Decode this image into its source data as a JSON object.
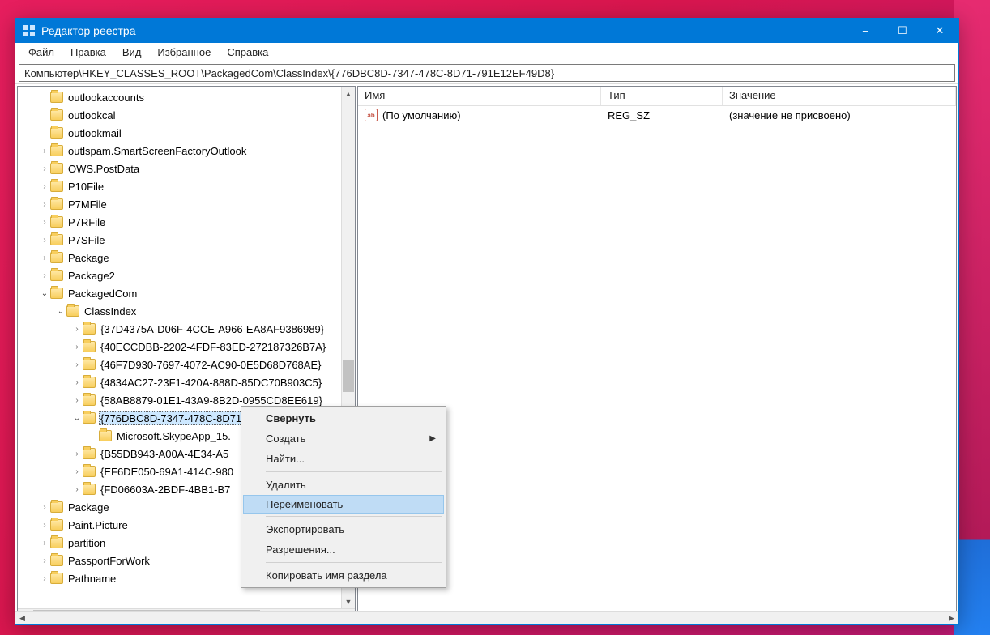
{
  "window": {
    "title": "Редактор реестра",
    "menubar": [
      "Файл",
      "Правка",
      "Вид",
      "Избранное",
      "Справка"
    ],
    "controls": {
      "min": "−",
      "max": "☐",
      "close": "✕"
    }
  },
  "address": "Компьютер\\HKEY_CLASSES_ROOT\\PackagedCom\\ClassIndex\\{776DBC8D-7347-478C-8D71-791E12EF49D8}",
  "tree": [
    {
      "indent": 1,
      "expander": "",
      "label": "outlookaccounts"
    },
    {
      "indent": 1,
      "expander": "",
      "label": "outlookcal"
    },
    {
      "indent": 1,
      "expander": "",
      "label": "outlookmail"
    },
    {
      "indent": 1,
      "expander": "closed",
      "label": "outlspam.SmartScreenFactoryOutlook"
    },
    {
      "indent": 1,
      "expander": "closed",
      "label": "OWS.PostData"
    },
    {
      "indent": 1,
      "expander": "closed",
      "label": "P10File"
    },
    {
      "indent": 1,
      "expander": "closed",
      "label": "P7MFile"
    },
    {
      "indent": 1,
      "expander": "closed",
      "label": "P7RFile"
    },
    {
      "indent": 1,
      "expander": "closed",
      "label": "P7SFile"
    },
    {
      "indent": 1,
      "expander": "closed",
      "label": "Package"
    },
    {
      "indent": 1,
      "expander": "closed",
      "label": "Package2"
    },
    {
      "indent": 1,
      "expander": "open",
      "label": "PackagedCom"
    },
    {
      "indent": 2,
      "expander": "open",
      "label": "ClassIndex"
    },
    {
      "indent": 3,
      "expander": "closed",
      "label": "{37D4375A-D06F-4CCE-A966-EA8AF9386989}"
    },
    {
      "indent": 3,
      "expander": "closed",
      "label": "{40ECCDBB-2202-4FDF-83ED-272187326B7A}"
    },
    {
      "indent": 3,
      "expander": "closed",
      "label": "{46F7D930-7697-4072-AC90-0E5D68D768AE}"
    },
    {
      "indent": 3,
      "expander": "closed",
      "label": "{4834AC27-23F1-420A-888D-85DC70B903C5}"
    },
    {
      "indent": 3,
      "expander": "closed",
      "label": "{58AB8879-01E1-43A9-8B2D-0955CD8EE619}"
    },
    {
      "indent": 3,
      "expander": "open",
      "label": "{776DBC8D-7347-478C-8D71-791E12EF49D8}",
      "selected": true
    },
    {
      "indent": 4,
      "expander": "",
      "label": "Microsoft.SkypeApp_15."
    },
    {
      "indent": 3,
      "expander": "closed",
      "label": "{B55DB943-A00A-4E34-A5"
    },
    {
      "indent": 3,
      "expander": "closed",
      "label": "{EF6DE050-69A1-414C-980"
    },
    {
      "indent": 3,
      "expander": "closed",
      "label": "{FD06603A-2BDF-4BB1-B7"
    },
    {
      "indent": 1,
      "expander": "closed",
      "label": "Package"
    },
    {
      "indent": 1,
      "expander": "closed",
      "label": "Paint.Picture"
    },
    {
      "indent": 1,
      "expander": "closed",
      "label": "partition"
    },
    {
      "indent": 1,
      "expander": "closed",
      "label": "PassportForWork"
    },
    {
      "indent": 1,
      "expander": "closed",
      "label": "Pathname"
    }
  ],
  "values": {
    "headers": {
      "name": "Имя",
      "type": "Тип",
      "data": "Значение"
    },
    "rows": [
      {
        "icon": "ab",
        "name": "(По умолчанию)",
        "type": "REG_SZ",
        "data": "(значение не присвоено)"
      }
    ]
  },
  "context_menu": {
    "items": [
      {
        "label": "Свернуть",
        "bold": true
      },
      {
        "label": "Создать",
        "submenu": true
      },
      {
        "label": "Найти..."
      },
      {
        "sep": true
      },
      {
        "label": "Удалить"
      },
      {
        "label": "Переименовать",
        "hover": true
      },
      {
        "sep": true
      },
      {
        "label": "Экспортировать"
      },
      {
        "label": "Разрешения..."
      },
      {
        "sep": true
      },
      {
        "label": "Копировать имя раздела"
      }
    ]
  }
}
